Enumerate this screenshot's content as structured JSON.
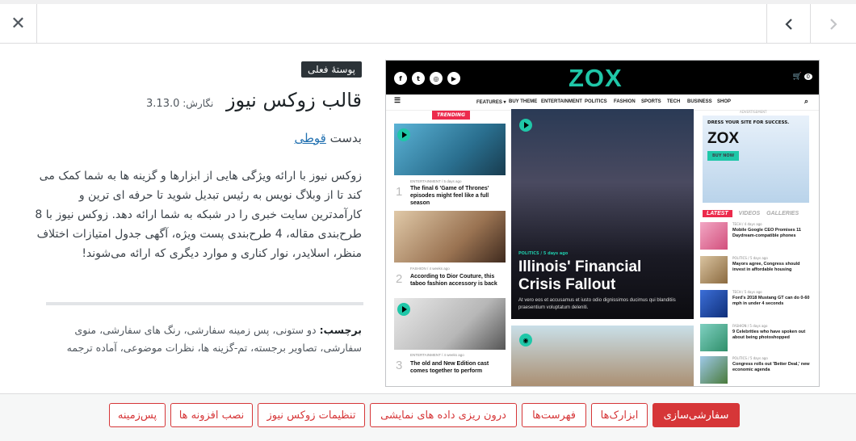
{
  "topbar": {
    "close_icon": "close-icon",
    "prev_icon": "chevron-left-icon",
    "next_icon": "chevron-right-icon"
  },
  "theme": {
    "current_badge": "پوستهٔ فعلی",
    "name": "قالب زوکس نیوز",
    "version_label": "نگارش:",
    "version": "3.13.0",
    "author_prefix": "بدست",
    "author_name": "قوطی",
    "description": "زوکس نیوز با ارائه ویژگی هایی از ابزارها و گزینه ها به شما کمک می کند تا از وبلاگ نویس به رئیس تبدیل شوید تا حرفه ای ترین و کارآمدترین سایت خبری را در شبکه به شما ارائه دهد. زوکس نیوز با 8 طرح‌بندی مقاله، 4 طرح‌بندی پست ویژه، آگهی جدول امتیازات اختلاف منظر، اسلایدر، نوار کناری و موارد دیگری که ارائه می‌شوند!",
    "tags_label": "برچسب:",
    "tags": "دو ستونی، پس زمینه سفارشی، رنگ های سفارشی، منوی سفارشی، تصاویر برجسته، تم-گزینه ها، نظرات موضوعی، آماده ترجمه"
  },
  "footer": {
    "buttons": [
      "سفارشی‌سازی",
      "ابزارک‌ها",
      "فهرست‌ها",
      "درون ریزی داده های نمایشی",
      "تنظیمات زوکس نیوز",
      "نصب افزونه ها",
      "پس‌زمینه"
    ]
  },
  "preview": {
    "logo": "ZOX",
    "cart_count": "0",
    "nav": [
      "FEATURES ▾",
      "BUY THEME",
      "ENTERTAINMENT",
      "POLITICS",
      "FASHION",
      "SPORTS",
      "TECH",
      "BUSINESS",
      "SHOP"
    ],
    "trending": "TRENDING",
    "left_items": [
      {
        "num": "1",
        "meta": "ENTERTAINMENT / 5 days ago",
        "title": "The final 6 'Game of Thrones' episodes might feel like a full season"
      },
      {
        "num": "2",
        "meta": "FASHION / 4 weeks ago",
        "title": "According to Dior Couture, this taboo fashion accessory is back"
      },
      {
        "num": "3",
        "meta": "ENTERTAINMENT / 4 weeks ago",
        "title": "The old and New Edition cast comes together to perform"
      }
    ],
    "main_category": "POLITICS / 5 days ago",
    "main_title": "Illinois' Financial Crisis Fallout",
    "main_excerpt": "At vero eos et accusamus et iusto odio dignissimos ducimus qui blanditiis praesentium voluptatum deleniti.",
    "ad_label": "ADVERTISEMENT",
    "ad_tagline": "DRESS YOUR SITE FOR SUCCESS.",
    "ad_logo": "ZOX",
    "ad_button": "BUY NOW",
    "tabs": [
      "LATEST",
      "VIDEOS",
      "GALLERIES"
    ],
    "right_items": [
      {
        "cat": "TECH / 4 days ago",
        "title": "Mobile Google CEO Promises 11 Daydream-compatible phones"
      },
      {
        "cat": "POLITICS / 5 days ago",
        "title": "Mayors agree, Congress should invest in affordable housing"
      },
      {
        "cat": "TECH / 5 days ago",
        "title": "Ford's 2018 Mustang GT can do 0-60 mph in under 4 seconds"
      },
      {
        "cat": "FASHION / 5 days ago",
        "title": "9 Celebrities who have spoken out about being photoshopped"
      },
      {
        "cat": "POLITICS / 5 days ago",
        "title": "Congress rolls out 'Better Deal,' new economic agenda"
      }
    ]
  },
  "colors": {
    "accent": "#d63638",
    "zox_green": "#1fc7a8",
    "trending_red": "#ec2a4c"
  }
}
